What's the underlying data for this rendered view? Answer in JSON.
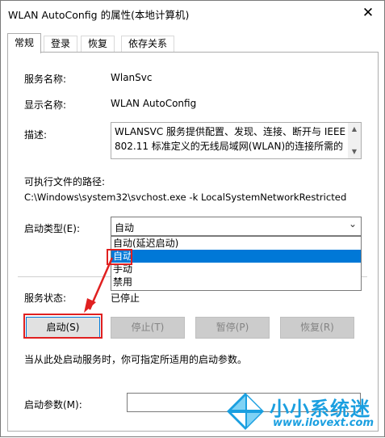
{
  "window": {
    "title": "WLAN AutoConfig 的属性(本地计算机)",
    "close_glyph": "✕"
  },
  "tabs": [
    {
      "label": "常规",
      "active": true
    },
    {
      "label": "登录",
      "active": false
    },
    {
      "label": "恢复",
      "active": false
    },
    {
      "label": "依存关系",
      "active": false
    }
  ],
  "general": {
    "service_name_label": "服务名称:",
    "service_name_value": "WlanSvc",
    "display_name_label": "显示名称:",
    "display_name_value": "WLAN AutoConfig",
    "description_label": "描述:",
    "description_value": "WLANSVC 服务提供配置、发现、连接、断开与 IEEE 802.11 标准定义的无线局域网(WLAN)的连接所需的",
    "exe_path_label": "可执行文件的路径:",
    "exe_path_value": "C:\\Windows\\system32\\svchost.exe -k LocalSystemNetworkRestricted",
    "startup_type_label": "启动类型(E):",
    "startup_type_value": "自动",
    "startup_options": [
      "自动(延迟启动)",
      "自动",
      "手动",
      "禁用"
    ],
    "startup_selected_index": 1,
    "service_status_label": "服务状态:",
    "service_status_value": "已停止"
  },
  "buttons": {
    "start": "启动(S)",
    "stop": "停止(T)",
    "pause": "暂停(P)",
    "resume": "恢复(R)"
  },
  "hint_text": "当从此处启动服务时，你可指定所适用的启动参数。",
  "start_params": {
    "label": "启动参数(M):",
    "value": ""
  },
  "watermark": {
    "name": "小小系统迷",
    "url": "www.ilovext.com",
    "icon": "windows-logo-icon"
  },
  "colors": {
    "selection": "#0078d7",
    "annotation_red": "#e02020",
    "watermark_blue": "#1a9fe0"
  }
}
